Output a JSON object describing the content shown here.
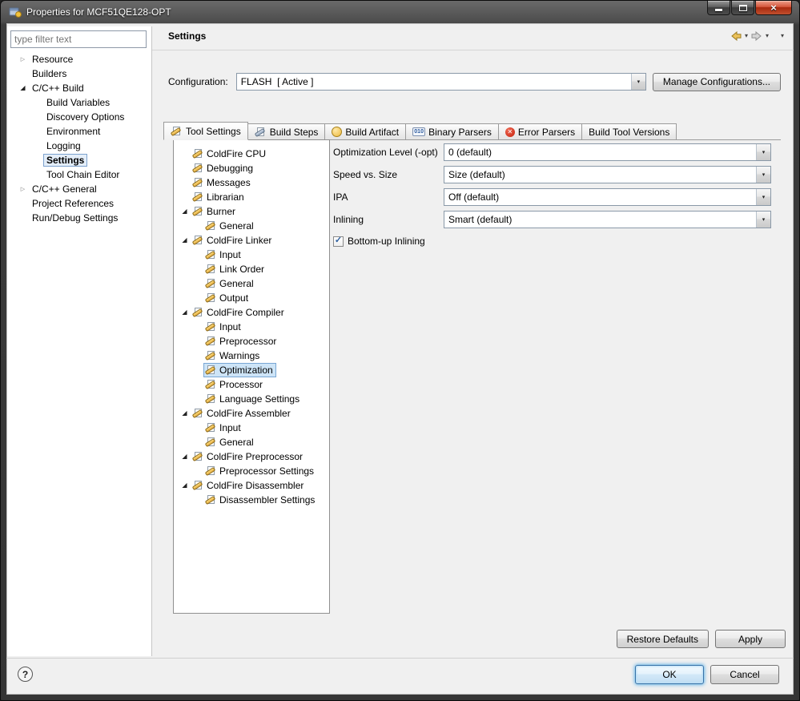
{
  "window": {
    "title": "Properties for MCF51QE128-OPT"
  },
  "sidebar": {
    "filter_placeholder": "type filter text",
    "tree": [
      {
        "label": "Resource",
        "arrow": "collapsed",
        "level": 0
      },
      {
        "label": "Builders",
        "arrow": "none",
        "level": 0
      },
      {
        "label": "C/C++ Build",
        "arrow": "expanded",
        "level": 0
      },
      {
        "label": "Build Variables",
        "arrow": "none",
        "level": 1
      },
      {
        "label": "Discovery Options",
        "arrow": "none",
        "level": 1
      },
      {
        "label": "Environment",
        "arrow": "none",
        "level": 1
      },
      {
        "label": "Logging",
        "arrow": "none",
        "level": 1
      },
      {
        "label": "Settings",
        "arrow": "none",
        "level": 1,
        "selected": true
      },
      {
        "label": "Tool Chain Editor",
        "arrow": "none",
        "level": 1
      },
      {
        "label": "C/C++ General",
        "arrow": "collapsed",
        "level": 0
      },
      {
        "label": "Project References",
        "arrow": "none",
        "level": 0
      },
      {
        "label": "Run/Debug Settings",
        "arrow": "none",
        "level": 0
      }
    ]
  },
  "main": {
    "header": {
      "title": "Settings"
    },
    "configuration": {
      "label": "Configuration:",
      "value": "FLASH  [ Active ]",
      "manage_button": "Manage Configurations..."
    },
    "tabs": [
      {
        "label": "Tool Settings",
        "icon": "wrench",
        "active": true
      },
      {
        "label": "Build Steps",
        "icon": "hammer",
        "active": false
      },
      {
        "label": "Build Artifact",
        "icon": "artifact",
        "active": false
      },
      {
        "label": "Binary Parsers",
        "icon": "binary",
        "active": false
      },
      {
        "label": "Error Parsers",
        "icon": "error",
        "active": false
      },
      {
        "label": "Build Tool Versions",
        "icon": null,
        "active": false
      }
    ],
    "tool_tree": [
      {
        "label": "ColdFire CPU",
        "arrow": "none",
        "level": 0
      },
      {
        "label": "Debugging",
        "arrow": "none",
        "level": 0
      },
      {
        "label": "Messages",
        "arrow": "none",
        "level": 0
      },
      {
        "label": "Librarian",
        "arrow": "none",
        "level": 0
      },
      {
        "label": "Burner",
        "arrow": "expanded",
        "level": 0
      },
      {
        "label": "General",
        "arrow": "none",
        "level": 1
      },
      {
        "label": "ColdFire Linker",
        "arrow": "expanded",
        "level": 0
      },
      {
        "label": "Input",
        "arrow": "none",
        "level": 1
      },
      {
        "label": "Link Order",
        "arrow": "none",
        "level": 1
      },
      {
        "label": "General",
        "arrow": "none",
        "level": 1
      },
      {
        "label": "Output",
        "arrow": "none",
        "level": 1
      },
      {
        "label": "ColdFire Compiler",
        "arrow": "expanded",
        "level": 0
      },
      {
        "label": "Input",
        "arrow": "none",
        "level": 1
      },
      {
        "label": "Preprocessor",
        "arrow": "none",
        "level": 1
      },
      {
        "label": "Warnings",
        "arrow": "none",
        "level": 1
      },
      {
        "label": "Optimization",
        "arrow": "none",
        "level": 1,
        "selected": true
      },
      {
        "label": "Processor",
        "arrow": "none",
        "level": 1
      },
      {
        "label": "Language Settings",
        "arrow": "none",
        "level": 1
      },
      {
        "label": "ColdFire Assembler",
        "arrow": "expanded",
        "level": 0
      },
      {
        "label": "Input",
        "arrow": "none",
        "level": 1
      },
      {
        "label": "General",
        "arrow": "none",
        "level": 1
      },
      {
        "label": "ColdFire Preprocessor",
        "arrow": "expanded",
        "level": 0
      },
      {
        "label": "Preprocessor Settings",
        "arrow": "none",
        "level": 1
      },
      {
        "label": "ColdFire Disassembler",
        "arrow": "expanded",
        "level": 0
      },
      {
        "label": "Disassembler Settings",
        "arrow": "none",
        "level": 1
      }
    ],
    "form": {
      "fields": [
        {
          "label": "Optimization Level (-opt)",
          "value": "0 (default)"
        },
        {
          "label": "Speed vs. Size",
          "value": "Size (default)"
        },
        {
          "label": "IPA",
          "value": "Off (default)"
        },
        {
          "label": "Inlining",
          "value": "Smart (default)"
        }
      ],
      "checkbox": {
        "label": "Bottom-up Inlining",
        "checked": true
      }
    },
    "action_buttons": {
      "restore_defaults": "Restore Defaults",
      "apply": "Apply"
    }
  },
  "footer": {
    "help": "?",
    "ok": "OK",
    "cancel": "Cancel"
  },
  "icons": {
    "twisty_expanded": "◢",
    "twisty_collapsed": "▷",
    "menu_caret": "▾",
    "combo_caret": "▾",
    "check": "✓",
    "binary_text": "010",
    "error_x": "✕",
    "close_x": "×"
  }
}
